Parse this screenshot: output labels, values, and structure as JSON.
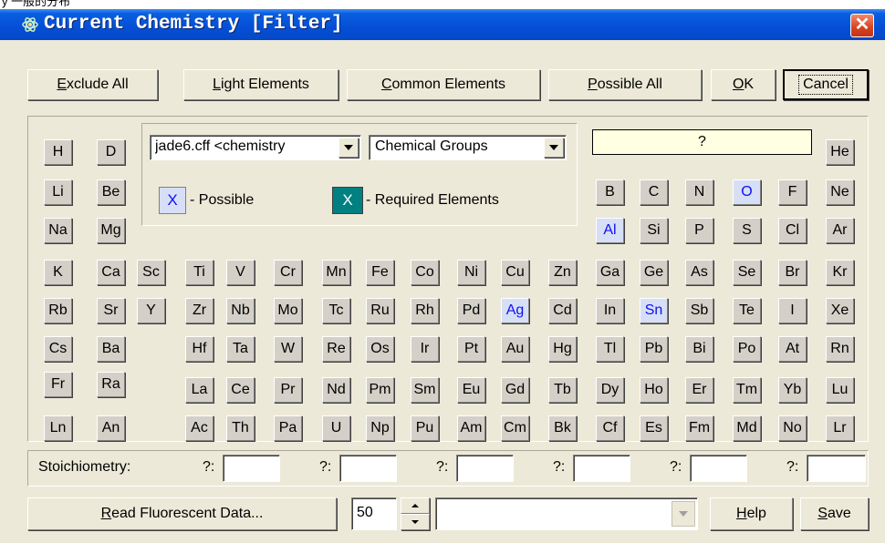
{
  "header_strip": "y 一般的分布",
  "window": {
    "title": "Current Chemistry [Filter]",
    "close_glyph": "✕"
  },
  "toolbar": {
    "exclude_all": {
      "prefix": "",
      "mnemonic": "E",
      "rest": "xclude All"
    },
    "light_elements": {
      "prefix": "",
      "mnemonic": "L",
      "rest": "ight Elements"
    },
    "common_elements": {
      "prefix": "",
      "mnemonic": "C",
      "rest": "ommon Elements"
    },
    "possible_all": {
      "prefix": "",
      "mnemonic": "P",
      "rest": "ossible All"
    },
    "ok": {
      "prefix": "",
      "mnemonic": "O",
      "rest": "K"
    },
    "cancel": "Cancel"
  },
  "controls": {
    "database_combo": "jade6.cff <chemistry",
    "groups_combo": "Chemical Groups",
    "query_field": "?",
    "legend_possible": "- Possible",
    "legend_required": "- Required Elements",
    "legend_mark": "X"
  },
  "elements": {
    "H": "H",
    "D": "D",
    "He": "He",
    "Li": "Li",
    "Be": "Be",
    "B": "B",
    "C": "C",
    "N": "N",
    "O": "O",
    "F": "F",
    "Ne": "Ne",
    "Na": "Na",
    "Mg": "Mg",
    "Al": "Al",
    "Si": "Si",
    "P": "P",
    "S": "S",
    "Cl": "Cl",
    "Ar": "Ar",
    "K": "K",
    "Ca": "Ca",
    "Sc": "Sc",
    "Ti": "Ti",
    "V": "V",
    "Cr": "Cr",
    "Mn": "Mn",
    "Fe": "Fe",
    "Co": "Co",
    "Ni": "Ni",
    "Cu": "Cu",
    "Zn": "Zn",
    "Ga": "Ga",
    "Ge": "Ge",
    "As": "As",
    "Se": "Se",
    "Br": "Br",
    "Kr": "Kr",
    "Rb": "Rb",
    "Sr": "Sr",
    "Y": "Y",
    "Zr": "Zr",
    "Nb": "Nb",
    "Mo": "Mo",
    "Tc": "Tc",
    "Ru": "Ru",
    "Rh": "Rh",
    "Pd": "Pd",
    "Ag": "Ag",
    "Cd": "Cd",
    "In": "In",
    "Sn": "Sn",
    "Sb": "Sb",
    "Te": "Te",
    "I": "I",
    "Xe": "Xe",
    "Cs": "Cs",
    "Ba": "Ba",
    "Hf": "Hf",
    "Ta": "Ta",
    "W": "W",
    "Re": "Re",
    "Os": "Os",
    "Ir": "Ir",
    "Pt": "Pt",
    "Au": "Au",
    "Hg": "Hg",
    "Tl": "Tl",
    "Pb": "Pb",
    "Bi": "Bi",
    "Po": "Po",
    "At": "At",
    "Rn": "Rn",
    "Fr": "Fr",
    "Ra": "Ra",
    "La": "La",
    "Ce": "Ce",
    "Pr": "Pr",
    "Nd": "Nd",
    "Pm": "Pm",
    "Sm": "Sm",
    "Eu": "Eu",
    "Gd": "Gd",
    "Tb": "Tb",
    "Dy": "Dy",
    "Ho": "Ho",
    "Er": "Er",
    "Tm": "Tm",
    "Yb": "Yb",
    "Lu": "Lu",
    "Ln": "Ln",
    "An": "An",
    "Ac": "Ac",
    "Th": "Th",
    "Pa": "Pa",
    "U": "U",
    "Np": "Np",
    "Pu": "Pu",
    "Am": "Am",
    "Cm": "Cm",
    "Bk": "Bk",
    "Cf": "Cf",
    "Es": "Es",
    "Fm": "Fm",
    "Md": "Md",
    "No": "No",
    "Lr": "Lr"
  },
  "possible_elements": [
    "O",
    "Al",
    "Ag",
    "Sn"
  ],
  "stoichiometry": {
    "label": "Stoichiometry:",
    "fields": [
      {
        "prefix": "?:",
        "value": ""
      },
      {
        "prefix": "?:",
        "value": ""
      },
      {
        "prefix": "?:",
        "value": ""
      },
      {
        "prefix": "?:",
        "value": ""
      },
      {
        "prefix": "?:",
        "value": ""
      },
      {
        "prefix": "?:",
        "value": ""
      }
    ]
  },
  "bottom": {
    "read_fluorescent": {
      "mnemonic": "R",
      "rest": "ead Fluorescent Data..."
    },
    "spinner_value": "50",
    "dropdown_value": "",
    "help": {
      "mnemonic": "H",
      "rest": "elp"
    },
    "save": {
      "mnemonic": "S",
      "rest": "ave"
    }
  },
  "colors": {
    "titlebar": "#0550d7",
    "close": "#d8431e",
    "possible_bg": "#d6dff5",
    "required_bg": "#008080",
    "face": "#ece9d8"
  }
}
